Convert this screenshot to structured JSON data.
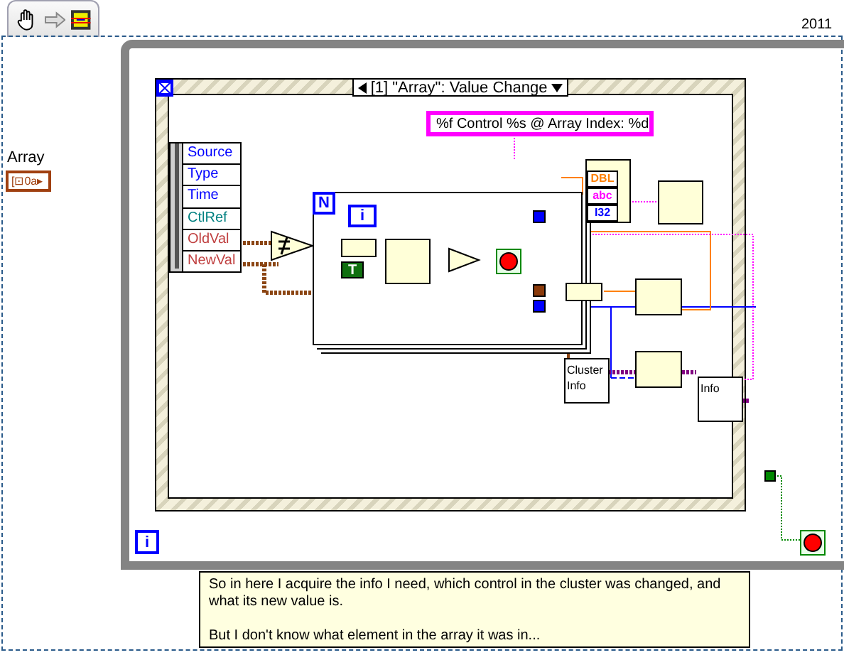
{
  "toolbar": {
    "version": "2011"
  },
  "array_control": {
    "label": "Array",
    "glyph": "[⊡0a▸"
  },
  "event_structure": {
    "case": "[1] \"Array\": Value Change",
    "data_items": [
      {
        "label": "Source",
        "color": "#0000ff"
      },
      {
        "label": "Type",
        "color": "#0000ff"
      },
      {
        "label": "Time",
        "color": "#0000ff"
      },
      {
        "label": "CtlRef",
        "color": "#008080"
      },
      {
        "label": "OldVal",
        "color": "#c04040"
      },
      {
        "label": "NewVal",
        "color": "#c04040"
      }
    ]
  },
  "for_loop": {
    "count": "N",
    "iteration": "i",
    "constant": "T"
  },
  "format_string": "%f Control %s @ Array Index: %d",
  "format_types": [
    {
      "label": "DBL",
      "color": "#ff8000"
    },
    {
      "label": "abc",
      "color": "#ff00ff"
    },
    {
      "label": "I32",
      "color": "#0000ff"
    }
  ],
  "nodes": [
    {
      "label": "Cluster Info"
    },
    {
      "label": "Info"
    }
  ],
  "while_loop": {
    "iteration": "i"
  },
  "comment": [
    "So in here I acquire the info I need, which control in the cluster was changed, and what its new value is.",
    "But I don't know what element in the array it was in..."
  ]
}
